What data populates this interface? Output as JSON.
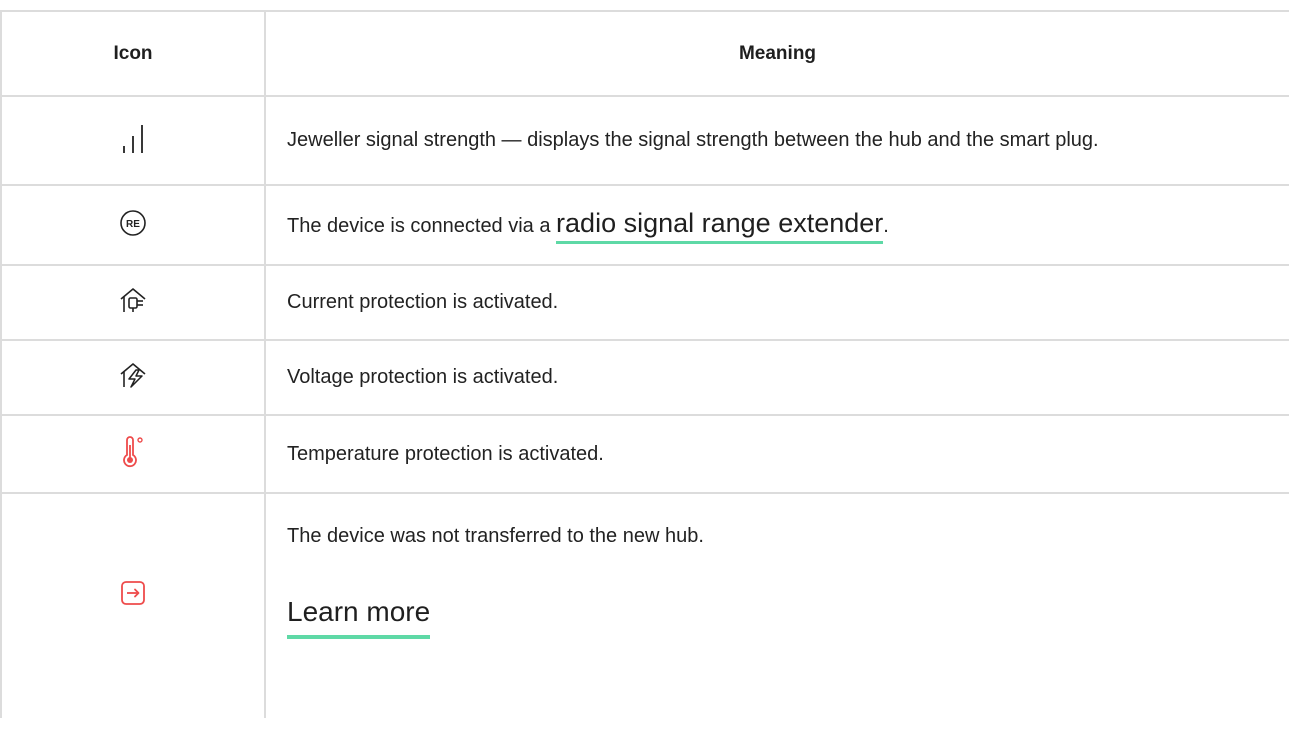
{
  "table": {
    "headers": {
      "icon": "Icon",
      "meaning": "Meaning"
    },
    "rows": {
      "signal": {
        "icon": "signal-strength-icon",
        "text": "Jeweller signal strength — displays the signal strength between the hub and the smart plug."
      },
      "re": {
        "icon": "range-extender-icon",
        "text_before": "The device is connected via a ",
        "link": "radio signal range extender",
        "text_after": "."
      },
      "current": {
        "icon": "current-protection-icon",
        "text": "Current protection is activated."
      },
      "voltage": {
        "icon": "voltage-protection-icon",
        "text": "Voltage protection is activated."
      },
      "temperature": {
        "icon": "temperature-protection-icon",
        "text": "Temperature protection is activated."
      },
      "transfer": {
        "icon": "not-transferred-icon",
        "text": "The device was not transferred to the new hub.",
        "link": "Learn more"
      }
    },
    "colors": {
      "accent_underline": "#5ed9a6",
      "alert_icon": "#ee4b4b",
      "border": "#dcdcdc"
    }
  }
}
